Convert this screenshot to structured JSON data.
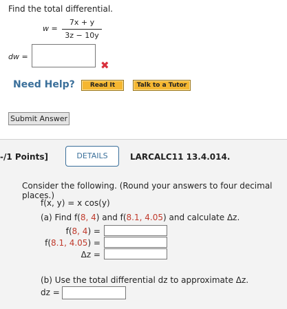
{
  "problem1": {
    "instruction": "Find the total differential.",
    "w_lhs": "w =",
    "numerator": "7x + y",
    "denominator": "3z − 10y",
    "dw_label": "dw =",
    "dw_value": "",
    "incorrect_mark": "✖",
    "need_help": "Need Help?",
    "read_it": "Read It",
    "talk_to_tutor": "Talk to a Tutor",
    "submit": "Submit Answer"
  },
  "problem2": {
    "points": "-/1 Points]",
    "details": "DETAILS",
    "problem_id": "LARCALC11 13.4.014.",
    "consider": "Consider the following. (Round your answers to four decimal places.)",
    "function": "f(x, y) = x cos(y)",
    "part_a_prefix": "(a) Find ",
    "part_a_f1": "f(",
    "part_a_p1": "8, 4",
    "part_a_mid": ") and f(",
    "part_a_p2": "8.1, 4.05",
    "part_a_suffix": ") and calculate Δz.",
    "rows": [
      {
        "label_pre": "f(",
        "label_pt": "8, 4",
        "label_post": ") =",
        "value": ""
      },
      {
        "label_pre": "f(",
        "label_pt": "8.1, 4.05",
        "label_post": ") =",
        "value": ""
      },
      {
        "label_pre": "",
        "label_pt": "",
        "label_post": "Δz =",
        "value": ""
      }
    ],
    "part_b": "(b) Use the total differential dz to approximate Δz.",
    "dz_label": "dz =",
    "dz_value": ""
  },
  "colors": {
    "link_blue": "#3a6f9a",
    "error_red": "#d9303d",
    "highlight_value": "#c0392b",
    "help_button": "#f5b731"
  }
}
